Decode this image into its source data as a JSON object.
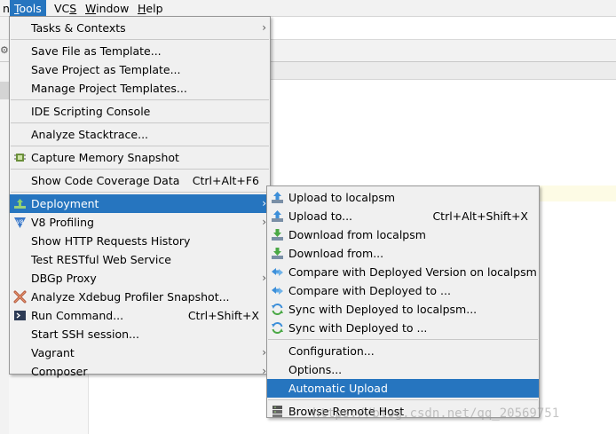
{
  "menubar": {
    "items": [
      {
        "label": "n"
      },
      {
        "label": "Tools",
        "mnemonic": "T",
        "rest": "ools"
      },
      {
        "label": "VCS",
        "mnemonic": "S",
        "pre": "VC"
      },
      {
        "label": "Window",
        "mnemonic": "W",
        "rest": "indow"
      },
      {
        "label": "Help",
        "mnemonic": "H",
        "rest": "elp"
      }
    ]
  },
  "tools_menu": {
    "items": [
      {
        "label": "Tasks & Contexts"
      },
      {
        "label": "Save File as Template..."
      },
      {
        "label": "Save Project as Template..."
      },
      {
        "label": "Manage Project Templates..."
      },
      {
        "label": "IDE Scripting Console"
      },
      {
        "label": "Analyze Stacktrace..."
      },
      {
        "label": "Capture Memory Snapshot"
      },
      {
        "label": "Show Code Coverage Data",
        "shortcut": "Ctrl+Alt+F6"
      },
      {
        "label": "Deployment"
      },
      {
        "label": "V8 Profiling"
      },
      {
        "label": "Show HTTP Requests History"
      },
      {
        "label": "Test RESTful Web Service"
      },
      {
        "label": "DBGp Proxy"
      },
      {
        "label": "Analyze Xdebug Profiler Snapshot..."
      },
      {
        "label": "Run Command...",
        "shortcut": "Ctrl+Shift+X"
      },
      {
        "label": "Start SSH session..."
      },
      {
        "label": "Vagrant"
      },
      {
        "label": "Composer"
      }
    ]
  },
  "deployment_menu": {
    "items": [
      {
        "label": "Upload to localpsm"
      },
      {
        "label": "Upload to...",
        "shortcut": "Ctrl+Alt+Shift+X"
      },
      {
        "label": "Download from localpsm"
      },
      {
        "label": "Download from..."
      },
      {
        "label": "Compare with Deployed Version on localpsm"
      },
      {
        "label": "Compare with Deployed to ..."
      },
      {
        "label": "Sync with Deployed to localpsm..."
      },
      {
        "label": "Sync with Deployed to ..."
      },
      {
        "label": "Configuration..."
      },
      {
        "label": "Options..."
      },
      {
        "label": "Automatic Upload"
      },
      {
        "label": "Browse Remote Host"
      }
    ]
  },
  "watermark": "https://blog.csdn.net/qq_20569751",
  "colors": {
    "highlight": "#2675bf",
    "menu_bg": "#f0f0f0"
  }
}
